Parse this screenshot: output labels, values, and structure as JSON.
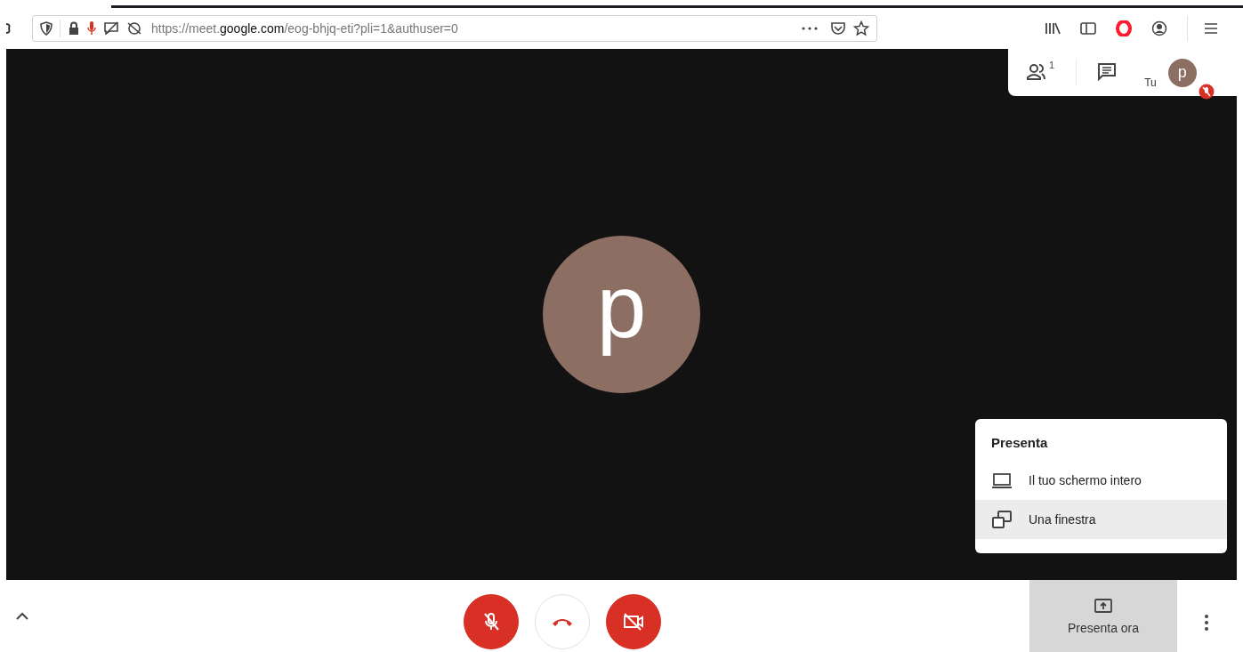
{
  "browser": {
    "url": {
      "prefix": "https://meet.",
      "domain": "google.com",
      "suffix": "/eog-bhjq-eti?pli=1&authuser=0"
    }
  },
  "top_panel": {
    "participants_count": "1",
    "self_label": "Tu",
    "self_avatar": "p",
    "self_muted": true
  },
  "stage": {
    "avatar": "p"
  },
  "present_menu": {
    "title": "Presenta",
    "items": [
      {
        "kind": "screen",
        "label": "Il tuo schermo intero",
        "selected": false
      },
      {
        "kind": "window",
        "label": "Una finestra",
        "selected": true
      }
    ]
  },
  "controls": [
    {
      "kind": "mic",
      "muted": true
    },
    {
      "kind": "hangup"
    },
    {
      "kind": "camera",
      "muted": true
    }
  ],
  "present_button": {
    "label": "Presenta ora",
    "selected": true
  }
}
